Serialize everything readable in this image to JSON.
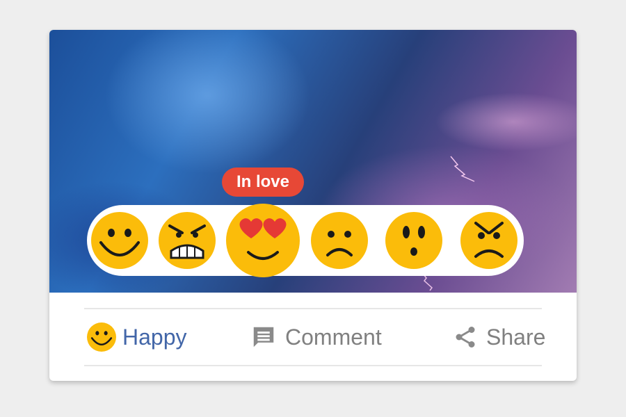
{
  "tooltip": {
    "label": "In love"
  },
  "reactions": [
    {
      "name": "happy",
      "icon": "smile-emoji-icon"
    },
    {
      "name": "angry",
      "icon": "angry-emoji-icon"
    },
    {
      "name": "in-love",
      "icon": "heart-eyes-emoji-icon"
    },
    {
      "name": "sad",
      "icon": "sad-emoji-icon"
    },
    {
      "name": "surprised",
      "icon": "surprised-emoji-icon"
    },
    {
      "name": "mad",
      "icon": "mad-emoji-icon"
    }
  ],
  "actions": {
    "react": {
      "label": "Happy",
      "icon": "smile-emoji-icon"
    },
    "comment": {
      "label": "Comment",
      "icon": "comment-icon"
    },
    "share": {
      "label": "Share",
      "icon": "share-icon"
    }
  },
  "colors": {
    "emoji_yellow": "#fbbc0a",
    "tooltip_red": "#e74836",
    "active_blue": "#4266a8",
    "inactive_gray": "#808080"
  }
}
